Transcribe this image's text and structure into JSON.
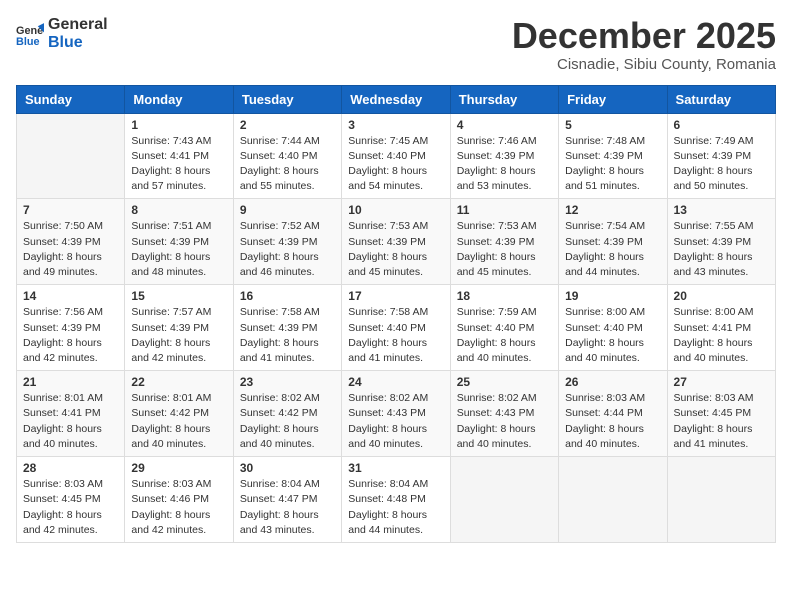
{
  "logo": {
    "general": "General",
    "blue": "Blue"
  },
  "header": {
    "month": "December 2025",
    "location": "Cisnadie, Sibiu County, Romania"
  },
  "weekdays": [
    "Sunday",
    "Monday",
    "Tuesday",
    "Wednesday",
    "Thursday",
    "Friday",
    "Saturday"
  ],
  "weeks": [
    [
      {
        "day": "",
        "sunrise": "",
        "sunset": "",
        "daylight": ""
      },
      {
        "day": "1",
        "sunrise": "Sunrise: 7:43 AM",
        "sunset": "Sunset: 4:41 PM",
        "daylight": "Daylight: 8 hours and 57 minutes."
      },
      {
        "day": "2",
        "sunrise": "Sunrise: 7:44 AM",
        "sunset": "Sunset: 4:40 PM",
        "daylight": "Daylight: 8 hours and 55 minutes."
      },
      {
        "day": "3",
        "sunrise": "Sunrise: 7:45 AM",
        "sunset": "Sunset: 4:40 PM",
        "daylight": "Daylight: 8 hours and 54 minutes."
      },
      {
        "day": "4",
        "sunrise": "Sunrise: 7:46 AM",
        "sunset": "Sunset: 4:39 PM",
        "daylight": "Daylight: 8 hours and 53 minutes."
      },
      {
        "day": "5",
        "sunrise": "Sunrise: 7:48 AM",
        "sunset": "Sunset: 4:39 PM",
        "daylight": "Daylight: 8 hours and 51 minutes."
      },
      {
        "day": "6",
        "sunrise": "Sunrise: 7:49 AM",
        "sunset": "Sunset: 4:39 PM",
        "daylight": "Daylight: 8 hours and 50 minutes."
      }
    ],
    [
      {
        "day": "7",
        "sunrise": "Sunrise: 7:50 AM",
        "sunset": "Sunset: 4:39 PM",
        "daylight": "Daylight: 8 hours and 49 minutes."
      },
      {
        "day": "8",
        "sunrise": "Sunrise: 7:51 AM",
        "sunset": "Sunset: 4:39 PM",
        "daylight": "Daylight: 8 hours and 48 minutes."
      },
      {
        "day": "9",
        "sunrise": "Sunrise: 7:52 AM",
        "sunset": "Sunset: 4:39 PM",
        "daylight": "Daylight: 8 hours and 46 minutes."
      },
      {
        "day": "10",
        "sunrise": "Sunrise: 7:53 AM",
        "sunset": "Sunset: 4:39 PM",
        "daylight": "Daylight: 8 hours and 45 minutes."
      },
      {
        "day": "11",
        "sunrise": "Sunrise: 7:53 AM",
        "sunset": "Sunset: 4:39 PM",
        "daylight": "Daylight: 8 hours and 45 minutes."
      },
      {
        "day": "12",
        "sunrise": "Sunrise: 7:54 AM",
        "sunset": "Sunset: 4:39 PM",
        "daylight": "Daylight: 8 hours and 44 minutes."
      },
      {
        "day": "13",
        "sunrise": "Sunrise: 7:55 AM",
        "sunset": "Sunset: 4:39 PM",
        "daylight": "Daylight: 8 hours and 43 minutes."
      }
    ],
    [
      {
        "day": "14",
        "sunrise": "Sunrise: 7:56 AM",
        "sunset": "Sunset: 4:39 PM",
        "daylight": "Daylight: 8 hours and 42 minutes."
      },
      {
        "day": "15",
        "sunrise": "Sunrise: 7:57 AM",
        "sunset": "Sunset: 4:39 PM",
        "daylight": "Daylight: 8 hours and 42 minutes."
      },
      {
        "day": "16",
        "sunrise": "Sunrise: 7:58 AM",
        "sunset": "Sunset: 4:39 PM",
        "daylight": "Daylight: 8 hours and 41 minutes."
      },
      {
        "day": "17",
        "sunrise": "Sunrise: 7:58 AM",
        "sunset": "Sunset: 4:40 PM",
        "daylight": "Daylight: 8 hours and 41 minutes."
      },
      {
        "day": "18",
        "sunrise": "Sunrise: 7:59 AM",
        "sunset": "Sunset: 4:40 PM",
        "daylight": "Daylight: 8 hours and 40 minutes."
      },
      {
        "day": "19",
        "sunrise": "Sunrise: 8:00 AM",
        "sunset": "Sunset: 4:40 PM",
        "daylight": "Daylight: 8 hours and 40 minutes."
      },
      {
        "day": "20",
        "sunrise": "Sunrise: 8:00 AM",
        "sunset": "Sunset: 4:41 PM",
        "daylight": "Daylight: 8 hours and 40 minutes."
      }
    ],
    [
      {
        "day": "21",
        "sunrise": "Sunrise: 8:01 AM",
        "sunset": "Sunset: 4:41 PM",
        "daylight": "Daylight: 8 hours and 40 minutes."
      },
      {
        "day": "22",
        "sunrise": "Sunrise: 8:01 AM",
        "sunset": "Sunset: 4:42 PM",
        "daylight": "Daylight: 8 hours and 40 minutes."
      },
      {
        "day": "23",
        "sunrise": "Sunrise: 8:02 AM",
        "sunset": "Sunset: 4:42 PM",
        "daylight": "Daylight: 8 hours and 40 minutes."
      },
      {
        "day": "24",
        "sunrise": "Sunrise: 8:02 AM",
        "sunset": "Sunset: 4:43 PM",
        "daylight": "Daylight: 8 hours and 40 minutes."
      },
      {
        "day": "25",
        "sunrise": "Sunrise: 8:02 AM",
        "sunset": "Sunset: 4:43 PM",
        "daylight": "Daylight: 8 hours and 40 minutes."
      },
      {
        "day": "26",
        "sunrise": "Sunrise: 8:03 AM",
        "sunset": "Sunset: 4:44 PM",
        "daylight": "Daylight: 8 hours and 40 minutes."
      },
      {
        "day": "27",
        "sunrise": "Sunrise: 8:03 AM",
        "sunset": "Sunset: 4:45 PM",
        "daylight": "Daylight: 8 hours and 41 minutes."
      }
    ],
    [
      {
        "day": "28",
        "sunrise": "Sunrise: 8:03 AM",
        "sunset": "Sunset: 4:45 PM",
        "daylight": "Daylight: 8 hours and 42 minutes."
      },
      {
        "day": "29",
        "sunrise": "Sunrise: 8:03 AM",
        "sunset": "Sunset: 4:46 PM",
        "daylight": "Daylight: 8 hours and 42 minutes."
      },
      {
        "day": "30",
        "sunrise": "Sunrise: 8:04 AM",
        "sunset": "Sunset: 4:47 PM",
        "daylight": "Daylight: 8 hours and 43 minutes."
      },
      {
        "day": "31",
        "sunrise": "Sunrise: 8:04 AM",
        "sunset": "Sunset: 4:48 PM",
        "daylight": "Daylight: 8 hours and 44 minutes."
      },
      {
        "day": "",
        "sunrise": "",
        "sunset": "",
        "daylight": ""
      },
      {
        "day": "",
        "sunrise": "",
        "sunset": "",
        "daylight": ""
      },
      {
        "day": "",
        "sunrise": "",
        "sunset": "",
        "daylight": ""
      }
    ]
  ]
}
